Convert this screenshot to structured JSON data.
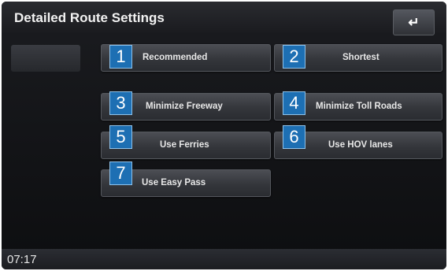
{
  "header": {
    "title": "Detailed Route Settings",
    "back_icon": "back-arrow-icon"
  },
  "options": [
    {
      "label": "Recommended",
      "marker": "1"
    },
    {
      "label": "Shortest",
      "marker": "2"
    },
    {
      "label": "Minimize Freeway",
      "marker": "3"
    },
    {
      "label": "Minimize Toll Roads",
      "marker": "4"
    },
    {
      "label": "Use Ferries",
      "marker": "5"
    },
    {
      "label": "Use HOV lanes",
      "marker": "6"
    },
    {
      "label": "Use Easy Pass",
      "marker": "7"
    }
  ],
  "status": {
    "time": "07:17"
  },
  "colors": {
    "marker_bg": "#1d6fb3",
    "background": "#131417"
  }
}
